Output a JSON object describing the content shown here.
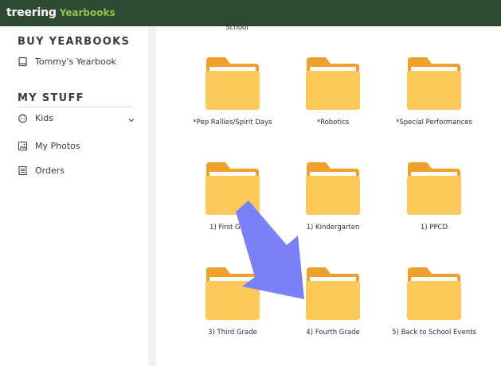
{
  "header": {
    "brand": "treering",
    "brand_sub": "Yearbooks"
  },
  "sidebar": {
    "buy_title": "BUY YEARBOOKS",
    "yearbook_item": "Tommy's Yearbook",
    "mystuff_title": "MY STUFF",
    "items": [
      {
        "label": "Kids",
        "icon": "kid-face-icon"
      },
      {
        "label": "My Photos",
        "icon": "photo-icon"
      },
      {
        "label": "Orders",
        "icon": "receipt-icon"
      }
    ]
  },
  "main": {
    "top_partial_label": "School",
    "folders": [
      {
        "label": "*Pep Rallies/Spirit Days"
      },
      {
        "label": "*Robotics"
      },
      {
        "label": "*Special Performances"
      },
      {
        "label": "1) First Grade"
      },
      {
        "label": "1) Kindergarten"
      },
      {
        "label": "1) PPCD"
      },
      {
        "label": "3) Third Grade"
      },
      {
        "label": "4) Fourth Grade"
      },
      {
        "label": "5) Back to School Events"
      }
    ]
  },
  "colors": {
    "topbar": "#2f4a33",
    "brand_accent": "#92c24d",
    "folder_back": "#f0a12b",
    "folder_front": "#fcc95a",
    "arrow": "#7a80f7"
  }
}
